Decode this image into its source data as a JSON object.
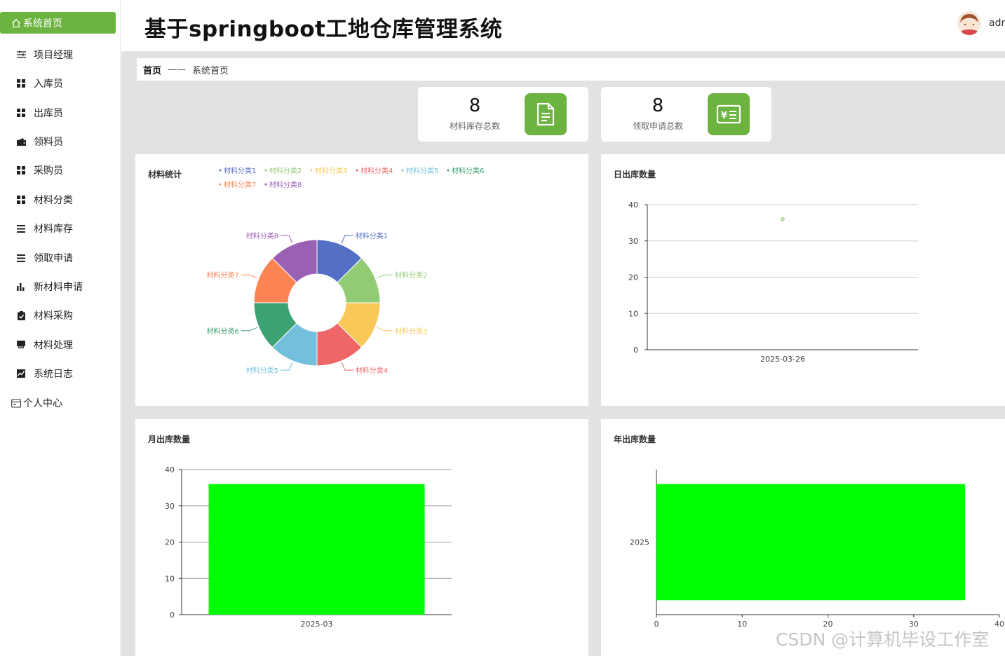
{
  "header": {
    "title": "基于springboot工地仓库管理系统",
    "username": "adr"
  },
  "sidebar": {
    "active": "系统首页",
    "items": [
      {
        "label": "项目经理",
        "icon": "sliders-icon"
      },
      {
        "label": "入库员",
        "icon": "grid-icon"
      },
      {
        "label": "出库员",
        "icon": "grid-icon"
      },
      {
        "label": "领料员",
        "icon": "wallet-icon"
      },
      {
        "label": "采购员",
        "icon": "grid-icon"
      },
      {
        "label": "材料分类",
        "icon": "grid-icon"
      },
      {
        "label": "材料库存",
        "icon": "list-icon"
      },
      {
        "label": "领取申请",
        "icon": "list-icon"
      },
      {
        "label": "新材料申请",
        "icon": "bar-chart-icon"
      },
      {
        "label": "材料采购",
        "icon": "clipboard-check-icon"
      },
      {
        "label": "材料处理",
        "icon": "printer-icon"
      },
      {
        "label": "系统日志",
        "icon": "line-chart-icon"
      }
    ],
    "personal": "个人中心"
  },
  "breadcrumb": {
    "home": "首页",
    "separator": "——",
    "current": "系统首页"
  },
  "stats": [
    {
      "value": "8",
      "label": "材料库存总数",
      "icon": "document-icon"
    },
    {
      "value": "8",
      "label": "领取申请总数",
      "icon": "yen-receipt-icon"
    }
  ],
  "colors": {
    "accent": "#6db33f",
    "bar": "#00ff00",
    "point": "#91cc75"
  },
  "watermark": "CSDN @计算机毕设工作室",
  "chart_data": [
    {
      "type": "pie",
      "title": "材料统计",
      "donut": true,
      "legend_position": "top",
      "slices": [
        {
          "name": "材料分类1",
          "value": 1,
          "color": "#5470c6"
        },
        {
          "name": "材料分类2",
          "value": 1,
          "color": "#91cc75"
        },
        {
          "name": "材料分类3",
          "value": 1,
          "color": "#fac858"
        },
        {
          "name": "材料分类4",
          "value": 1,
          "color": "#ee6666"
        },
        {
          "name": "材料分类5",
          "value": 1,
          "color": "#73c0de"
        },
        {
          "name": "材料分类6",
          "value": 1,
          "color": "#3ba272"
        },
        {
          "name": "材料分类7",
          "value": 1,
          "color": "#fc8452"
        },
        {
          "name": "材料分类8",
          "value": 1,
          "color": "#9a60b4"
        }
      ]
    },
    {
      "type": "scatter",
      "title": "日出库数量",
      "categories": [
        "2025-03-26"
      ],
      "values": [
        36
      ],
      "ylim": [
        0,
        40
      ],
      "yticks": [
        0,
        10,
        20,
        30,
        40
      ],
      "grid": true
    },
    {
      "type": "bar",
      "title": "月出库数量",
      "categories": [
        "2025-03"
      ],
      "values": [
        36
      ],
      "ylim": [
        0,
        40
      ],
      "yticks": [
        0,
        10,
        20,
        30,
        40
      ],
      "grid": true
    },
    {
      "type": "bar",
      "orientation": "horizontal",
      "title": "年出库数量",
      "categories": [
        "2025"
      ],
      "values": [
        36
      ],
      "xlim": [
        0,
        40
      ],
      "xticks": [
        0,
        10,
        20,
        30,
        40
      ],
      "grid": false
    }
  ]
}
